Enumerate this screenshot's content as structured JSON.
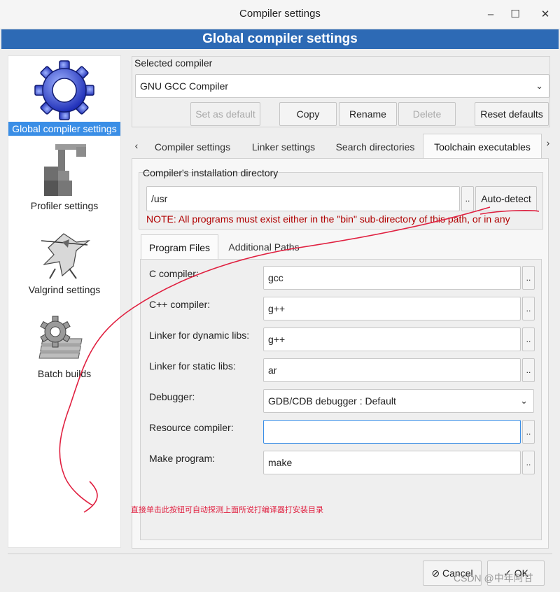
{
  "window": {
    "title": "Compiler settings",
    "header": "Global compiler settings"
  },
  "sidebar": {
    "items": [
      {
        "label": "Global compiler settings",
        "icon": "gear-icon",
        "selected": true
      },
      {
        "label": "Profiler settings",
        "icon": "profiler-icon",
        "selected": false
      },
      {
        "label": "Valgrind settings",
        "icon": "valgrind-icon",
        "selected": false
      },
      {
        "label": "Batch builds",
        "icon": "batch-builds-icon",
        "selected": false
      }
    ]
  },
  "compiler": {
    "section_label": "Selected compiler",
    "selected": "GNU GCC Compiler",
    "buttons": {
      "set_default": "Set as default",
      "copy": "Copy",
      "rename": "Rename",
      "delete": "Delete",
      "reset": "Reset defaults"
    }
  },
  "tabs": {
    "left_arrow": "‹",
    "right_arrow": "›",
    "items": [
      "Compiler settings",
      "Linker settings",
      "Search directories",
      "Toolchain executables"
    ],
    "active": "Toolchain executables"
  },
  "install": {
    "label": "Compiler's installation directory",
    "value": "/usr",
    "browse": "..",
    "auto_detect": "Auto-detect",
    "note": "NOTE: All programs must exist either in the \"bin\" sub-directory of this path, or in any"
  },
  "subtabs": {
    "items": [
      "Program Files",
      "Additional Paths"
    ],
    "active": "Program Files"
  },
  "programs": {
    "c_compiler": {
      "label": "C compiler:",
      "value": "gcc"
    },
    "cpp_compiler": {
      "label": "C++ compiler:",
      "value": "g++"
    },
    "linker_dynamic": {
      "label": "Linker for dynamic libs:",
      "value": "g++"
    },
    "linker_static": {
      "label": "Linker for static libs:",
      "value": "ar"
    },
    "debugger": {
      "label": "Debugger:",
      "value": "GDB/CDB debugger : Default"
    },
    "resource_compiler": {
      "label": "Resource compiler:",
      "value": ""
    },
    "make": {
      "label": "Make program:",
      "value": "make"
    },
    "browse": ".."
  },
  "annotation": "直接单击此按钮可自动探测上面所说打编译器打安装目录",
  "footer": {
    "cancel": "Cancel",
    "ok": "OK",
    "watermark": "CSDN @中年阿甘"
  },
  "colors": {
    "accent": "#2d6ab5",
    "selection": "#3a8ee6",
    "note": "#b00000",
    "annotation": "#e02040"
  }
}
